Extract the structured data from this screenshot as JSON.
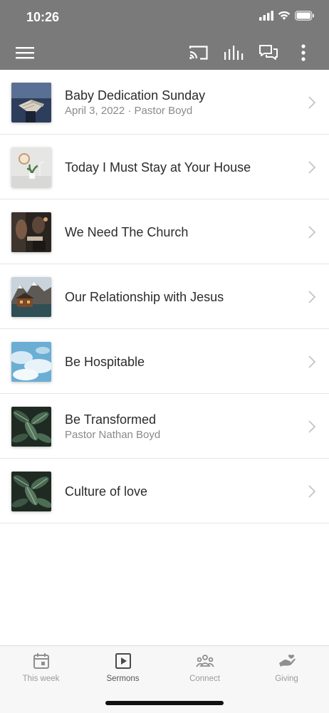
{
  "status_bar": {
    "time": "10:26"
  },
  "toolbar": {
    "icons": [
      "menu-icon",
      "cast-icon",
      "audio-bars-icon",
      "chat-icon",
      "more-vertical-icon"
    ]
  },
  "sermons": [
    {
      "title": "Baby Dedication Sunday",
      "subtitle": "April 3, 2022 · Pastor Boyd",
      "thumb": "bible-photo"
    },
    {
      "title": "Today I Must Stay at Your House",
      "subtitle": "",
      "thumb": "clock-plant-photo"
    },
    {
      "title": "We Need The Church",
      "subtitle": "",
      "thumb": "people-photo"
    },
    {
      "title": "Our Relationship with Jesus",
      "subtitle": "",
      "thumb": "mountain-lake-photo"
    },
    {
      "title": "Be Hospitable",
      "subtitle": "",
      "thumb": "sky-clouds-photo"
    },
    {
      "title": "Be Transformed",
      "subtitle": "Pastor Nathan Boyd",
      "thumb": "leaves-photo"
    },
    {
      "title": "Culture of love",
      "subtitle": "",
      "thumb": "leaves-photo"
    }
  ],
  "tabs": [
    {
      "label": "This week",
      "icon": "calendar-icon",
      "active": false
    },
    {
      "label": "Sermons",
      "icon": "play-square-icon",
      "active": true
    },
    {
      "label": "Connect",
      "icon": "people-group-icon",
      "active": false
    },
    {
      "label": "Giving",
      "icon": "giving-hand-icon",
      "active": false
    }
  ],
  "colors": {
    "header_bg": "#7a7a7a",
    "text": "#2b2b2b",
    "subtext": "#8a8a8a",
    "tab_inactive": "#9a9a9a"
  }
}
